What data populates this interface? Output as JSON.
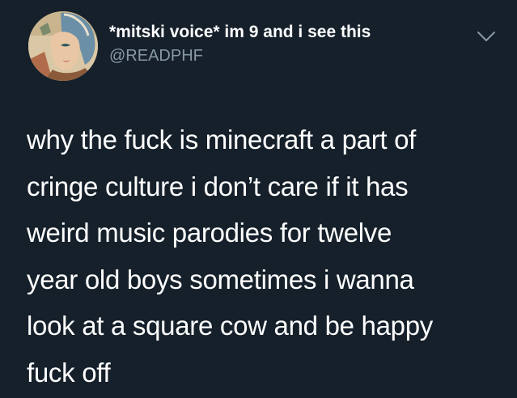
{
  "tweet": {
    "author": {
      "display_name": "*mitski voice* im 9 and i see this",
      "handle": "@READPHF",
      "avatar_icon": "anime-character-avatar"
    },
    "menu_icon": "chevron-down-icon",
    "text_lines": [
      "why the fuck is minecraft a part of",
      "cringe culture i don’t care if it has",
      "weird music parodies for twelve",
      "year old boys sometimes i wanna",
      "look at a square cow and be happy",
      "fuck off"
    ]
  },
  "colors": {
    "background": "#15202b",
    "text": "#ffffff",
    "secondary_text": "#8899a6"
  }
}
